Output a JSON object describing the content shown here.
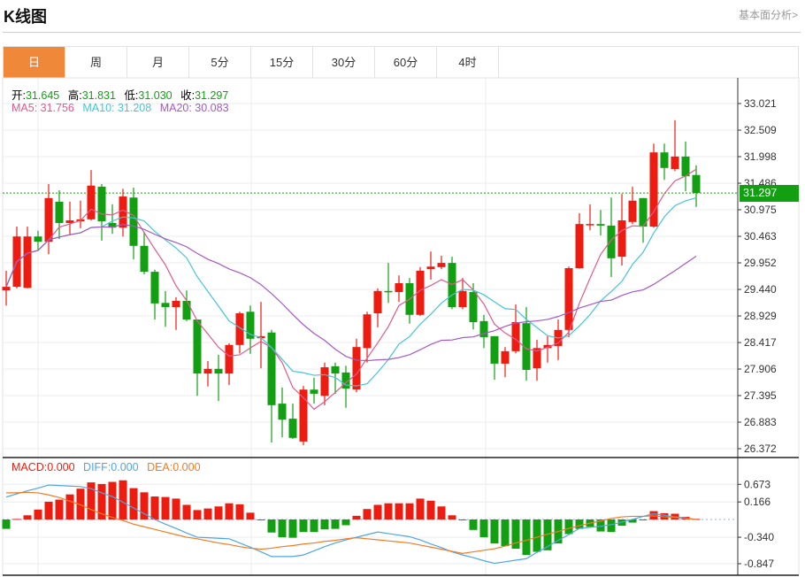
{
  "header": {
    "title": "K线图",
    "link": "基本面分析>"
  },
  "tabs": [
    {
      "label": "日",
      "active": true
    },
    {
      "label": "周"
    },
    {
      "label": "月"
    },
    {
      "label": "5分"
    },
    {
      "label": "15分"
    },
    {
      "label": "30分"
    },
    {
      "label": "60分"
    },
    {
      "label": "4时"
    }
  ],
  "ohlc_legend": {
    "open_label": "开:",
    "open": "31.645",
    "high_label": "高:",
    "high": "31.831",
    "low_label": "低:",
    "low": "31.030",
    "close_label": "收:",
    "close": "31.297"
  },
  "ma_legend": {
    "ma5": "MA5: 31.756",
    "ma10": "MA10: 31.208",
    "ma20": "MA20: 30.083"
  },
  "macd_legend": {
    "macd": "MACD:0.000",
    "diff": "DIFF:0.000",
    "dea": "DEA:0.000"
  },
  "current_price": "31.297",
  "colors": {
    "up": "#ee1c10",
    "down": "#12a012",
    "ma5": "#e05a8c",
    "ma10": "#45c4d8",
    "ma20": "#a459c2",
    "diff": "#4ea6e2",
    "dea": "#f07c24",
    "accent": "#f0883a"
  },
  "chart_data": [
    {
      "type": "candlestick",
      "yticks": [
        "33.021",
        "32.509",
        "31.998",
        "31.486",
        "30.975",
        "30.463",
        "29.952",
        "29.440",
        "28.929",
        "28.417",
        "27.906",
        "27.395",
        "26.883",
        "26.372"
      ],
      "ylim": [
        26.372,
        33.021
      ],
      "open": [
        29.42,
        29.49,
        29.47,
        30.46,
        30.36,
        31.13,
        30.72,
        30.75,
        30.79,
        31.42,
        30.72,
        30.63,
        31.21,
        30.28,
        29.78,
        29.18,
        29.1,
        29.22,
        28.86,
        27.82,
        27.91,
        27.82,
        28.37,
        29.01,
        28.5,
        28.61,
        27.24,
        26.95,
        26.51,
        27.51,
        27.39,
        27.96,
        27.84,
        27.51,
        28.31,
        28.98,
        29.41,
        29.39,
        29.56,
        28.95,
        29.83,
        29.87,
        29.95,
        29.1,
        29.39,
        28.83,
        28.54,
        28.01,
        28.25,
        28.79,
        27.92,
        28.31,
        28.35,
        28.66,
        29.85,
        30.69,
        30.7,
        30.67,
        30.07,
        30.74,
        31.2,
        30.65,
        32.08,
        31.76,
        32.0,
        31.645
      ],
      "high": [
        29.8,
        30.65,
        30.65,
        30.57,
        31.47,
        31.35,
        31.13,
        31.15,
        31.74,
        31.47,
        31.08,
        31.38,
        31.4,
        30.55,
        29.82,
        29.41,
        29.29,
        29.42,
        28.86,
        28.06,
        28.18,
        28.4,
        29.01,
        29.13,
        29.2,
        28.66,
        27.55,
        27.24,
        27.58,
        27.74,
        28.03,
        28.03,
        27.97,
        28.49,
        29.01,
        29.46,
        29.95,
        29.71,
        29.66,
        29.87,
        30.17,
        30.09,
        30.07,
        29.66,
        29.56,
        28.95,
        28.54,
        28.33,
        29.15,
        29.1,
        28.47,
        28.54,
        28.86,
        29.88,
        30.91,
        31.08,
        30.97,
        31.21,
        31.28,
        31.42,
        31.2,
        32.25,
        32.25,
        32.7,
        32.29,
        31.831
      ],
      "low": [
        29.13,
        29.46,
        29.46,
        30.19,
        30.12,
        30.41,
        30.48,
        30.62,
        30.77,
        30.38,
        30.51,
        30.46,
        30.02,
        29.73,
        28.86,
        28.72,
        28.66,
        28.83,
        27.39,
        27.57,
        27.29,
        27.6,
        28.21,
        28.2,
        27.92,
        26.49,
        26.59,
        26.56,
        26.44,
        27.24,
        27.21,
        27.43,
        27.16,
        27.46,
        28.03,
        28.71,
        29.18,
        29.2,
        28.78,
        28.93,
        29.63,
        29.83,
        29.06,
        29.06,
        28.67,
        28.31,
        27.7,
        27.75,
        28.21,
        27.68,
        27.68,
        28.03,
        28.08,
        28.52,
        29.84,
        30.58,
        30.48,
        29.68,
        29.9,
        30.7,
        30.34,
        30.63,
        31.55,
        31.72,
        31.33,
        31.03
      ],
      "close": [
        29.49,
        30.46,
        30.46,
        30.36,
        31.2,
        30.72,
        30.77,
        30.79,
        31.44,
        30.75,
        30.63,
        31.23,
        30.28,
        29.78,
        29.17,
        29.1,
        29.22,
        28.86,
        27.82,
        27.91,
        27.82,
        28.37,
        28.98,
        28.49,
        28.54,
        27.21,
        26.93,
        26.58,
        27.51,
        27.43,
        27.94,
        27.82,
        27.53,
        28.33,
        28.96,
        29.41,
        29.39,
        29.56,
        28.95,
        29.8,
        29.88,
        29.95,
        29.1,
        29.41,
        28.81,
        28.52,
        28.01,
        28.25,
        28.81,
        27.89,
        28.31,
        28.37,
        28.66,
        29.85,
        30.7,
        30.7,
        30.67,
        30.04,
        30.77,
        31.15,
        30.65,
        32.08,
        31.78,
        32.0,
        31.62,
        31.297
      ]
    },
    {
      "type": "macd",
      "yticks": [
        "0.673",
        "0.166",
        "-0.340",
        "-0.847"
      ],
      "macd": [
        -0.18,
        0.01,
        0.08,
        0.19,
        0.34,
        0.38,
        0.48,
        0.59,
        0.71,
        0.68,
        0.72,
        0.75,
        0.6,
        0.52,
        0.44,
        0.43,
        0.4,
        0.28,
        0.18,
        0.21,
        0.25,
        0.31,
        0.29,
        0.13,
        -0.01,
        -0.25,
        -0.34,
        -0.35,
        -0.24,
        -0.24,
        -0.19,
        -0.18,
        -0.11,
        0.07,
        0.2,
        0.28,
        0.31,
        0.31,
        0.31,
        0.4,
        0.36,
        0.25,
        0.08,
        -0.01,
        -0.2,
        -0.34,
        -0.46,
        -0.51,
        -0.56,
        -0.68,
        -0.62,
        -0.59,
        -0.46,
        -0.28,
        -0.18,
        -0.14,
        -0.23,
        -0.24,
        -0.12,
        -0.06,
        -0.01,
        0.16,
        0.12,
        0.11,
        0.05,
        0.01
      ],
      "diff": [
        0.43,
        0.49,
        0.55,
        0.6,
        0.66,
        0.65,
        0.64,
        0.63,
        0.59,
        0.51,
        0.44,
        0.33,
        0.22,
        0.11,
        0.0,
        -0.09,
        -0.17,
        -0.26,
        -0.34,
        -0.35,
        -0.36,
        -0.37,
        -0.45,
        -0.53,
        -0.62,
        -0.71,
        -0.71,
        -0.71,
        -0.68,
        -0.6,
        -0.52,
        -0.45,
        -0.39,
        -0.34,
        -0.29,
        -0.24,
        -0.27,
        -0.3,
        -0.33,
        -0.39,
        -0.47,
        -0.54,
        -0.62,
        -0.68,
        -0.73,
        -0.79,
        -0.84,
        -0.81,
        -0.78,
        -0.75,
        -0.63,
        -0.52,
        -0.4,
        -0.29,
        -0.17,
        -0.15,
        -0.13,
        -0.1,
        -0.05,
        0.0,
        0.06,
        0.11,
        0.08,
        0.05,
        0.03,
        0.0
      ],
      "dea": [
        0.51,
        0.51,
        0.52,
        0.51,
        0.47,
        0.42,
        0.35,
        0.28,
        0.19,
        0.11,
        0.04,
        -0.02,
        -0.09,
        -0.14,
        -0.19,
        -0.24,
        -0.29,
        -0.34,
        -0.37,
        -0.41,
        -0.45,
        -0.48,
        -0.52,
        -0.55,
        -0.57,
        -0.55,
        -0.52,
        -0.5,
        -0.47,
        -0.45,
        -0.42,
        -0.4,
        -0.37,
        -0.35,
        -0.37,
        -0.39,
        -0.41,
        -0.43,
        -0.45,
        -0.49,
        -0.53,
        -0.57,
        -0.61,
        -0.65,
        -0.62,
        -0.59,
        -0.56,
        -0.51,
        -0.45,
        -0.4,
        -0.34,
        -0.28,
        -0.23,
        -0.17,
        -0.12,
        -0.07,
        -0.03,
        0.02,
        0.05,
        0.06,
        0.06,
        0.07,
        0.05,
        0.04,
        0.02,
        0.0
      ]
    }
  ]
}
